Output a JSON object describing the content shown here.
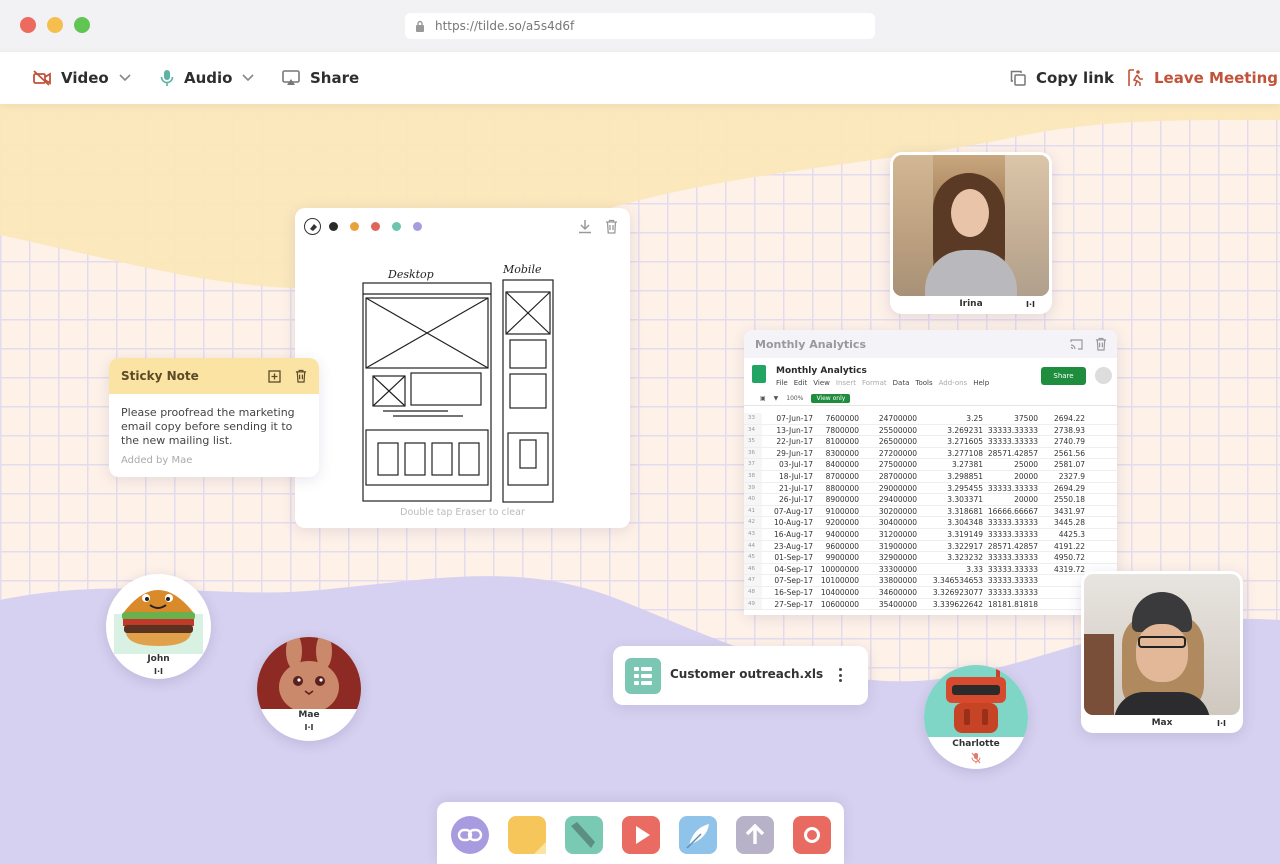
{
  "browser": {
    "url": "https://tilde.so/a5s4d6f"
  },
  "toolbar": {
    "video_label": "Video",
    "audio_label": "Audio",
    "share_label": "Share",
    "copy_link_label": "Copy link",
    "leave_label": "Leave Meeting",
    "leave_color": "#c0533a"
  },
  "whiteboard": {
    "colors": [
      "#2b2b2b",
      "#e9a23b",
      "#e0665a",
      "#6cc3b0",
      "#a99be0"
    ],
    "sketch_labels": {
      "desktop": "Desktop",
      "mobile": "Mobile"
    },
    "hint": "Double tap Eraser to clear"
  },
  "sticky": {
    "title": "Sticky Note",
    "text": "Please proofread the marketing email copy before sending it to the new mailing list.",
    "added_by": "Added by Mae"
  },
  "spreadsheet": {
    "panel_title": "Monthly Analytics",
    "doc_title": "Monthly Analytics",
    "menu": [
      "File",
      "Edit",
      "View",
      "Insert",
      "Format",
      "Data",
      "Tools",
      "Add-ons",
      "Help"
    ],
    "share_label": "Share",
    "view_only_label": "View only",
    "zoom": "100%",
    "rows": [
      [
        "33",
        "07-Jun-17",
        "7600000",
        "24700000",
        "3.25",
        "37500",
        "2694.22"
      ],
      [
        "34",
        "13-Jun-17",
        "7800000",
        "25500000",
        "3.269231",
        "33333.33333",
        "2738.93"
      ],
      [
        "35",
        "22-Jun-17",
        "8100000",
        "26500000",
        "3.271605",
        "33333.33333",
        "2740.79"
      ],
      [
        "36",
        "29-Jun-17",
        "8300000",
        "27200000",
        "3.277108",
        "28571.42857",
        "2561.56"
      ],
      [
        "37",
        "03-Jul-17",
        "8400000",
        "27500000",
        "3.27381",
        "25000",
        "2581.07"
      ],
      [
        "38",
        "18-Jul-17",
        "8700000",
        "28700000",
        "3.298851",
        "20000",
        "2327.9"
      ],
      [
        "39",
        "21-Jul-17",
        "8800000",
        "29000000",
        "3.295455",
        "33333.33333",
        "2694.29"
      ],
      [
        "40",
        "26-Jul-17",
        "8900000",
        "29400000",
        "3.303371",
        "20000",
        "2550.18"
      ],
      [
        "41",
        "07-Aug-17",
        "9100000",
        "30200000",
        "3.318681",
        "16666.66667",
        "3431.97"
      ],
      [
        "42",
        "10-Aug-17",
        "9200000",
        "30400000",
        "3.304348",
        "33333.33333",
        "3445.28"
      ],
      [
        "43",
        "16-Aug-17",
        "9400000",
        "31200000",
        "3.319149",
        "33333.33333",
        "4425.3"
      ],
      [
        "44",
        "23-Aug-17",
        "9600000",
        "31900000",
        "3.322917",
        "28571.42857",
        "4191.22"
      ],
      [
        "45",
        "01-Sep-17",
        "9900000",
        "32900000",
        "3.323232",
        "33333.33333",
        "4950.72"
      ],
      [
        "46",
        "04-Sep-17",
        "10000000",
        "33300000",
        "3.33",
        "33333.33333",
        "4319.72"
      ],
      [
        "47",
        "07-Sep-17",
        "10100000",
        "33800000",
        "3.346534653",
        "33333.33333",
        ""
      ],
      [
        "48",
        "16-Sep-17",
        "10400000",
        "34600000",
        "3.326923077",
        "33333.33333",
        ""
      ],
      [
        "49",
        "27-Sep-17",
        "10600000",
        "35400000",
        "3.339622642",
        "18181.81818",
        ""
      ]
    ]
  },
  "file": {
    "name": "Customer outreach.xls"
  },
  "participants": {
    "irina": {
      "name": "Irina"
    },
    "max": {
      "name": "Max"
    },
    "john": {
      "name": "John"
    },
    "mae": {
      "name": "Mae"
    },
    "charlotte": {
      "name": "Charlotte"
    }
  },
  "dock": {
    "buttons": [
      {
        "icon": "link-icon",
        "color": "#a99be0"
      },
      {
        "icon": "sticky-note-icon",
        "color": "#f7c65a"
      },
      {
        "icon": "marker-icon",
        "color": "#7ac9b3"
      },
      {
        "icon": "play-icon",
        "color": "#ea6b62"
      },
      {
        "icon": "feather-icon",
        "color": "#8fc3ea"
      },
      {
        "icon": "upload-icon",
        "color": "#b7b2c7"
      },
      {
        "icon": "record-icon",
        "color": "#e96a60"
      }
    ]
  }
}
